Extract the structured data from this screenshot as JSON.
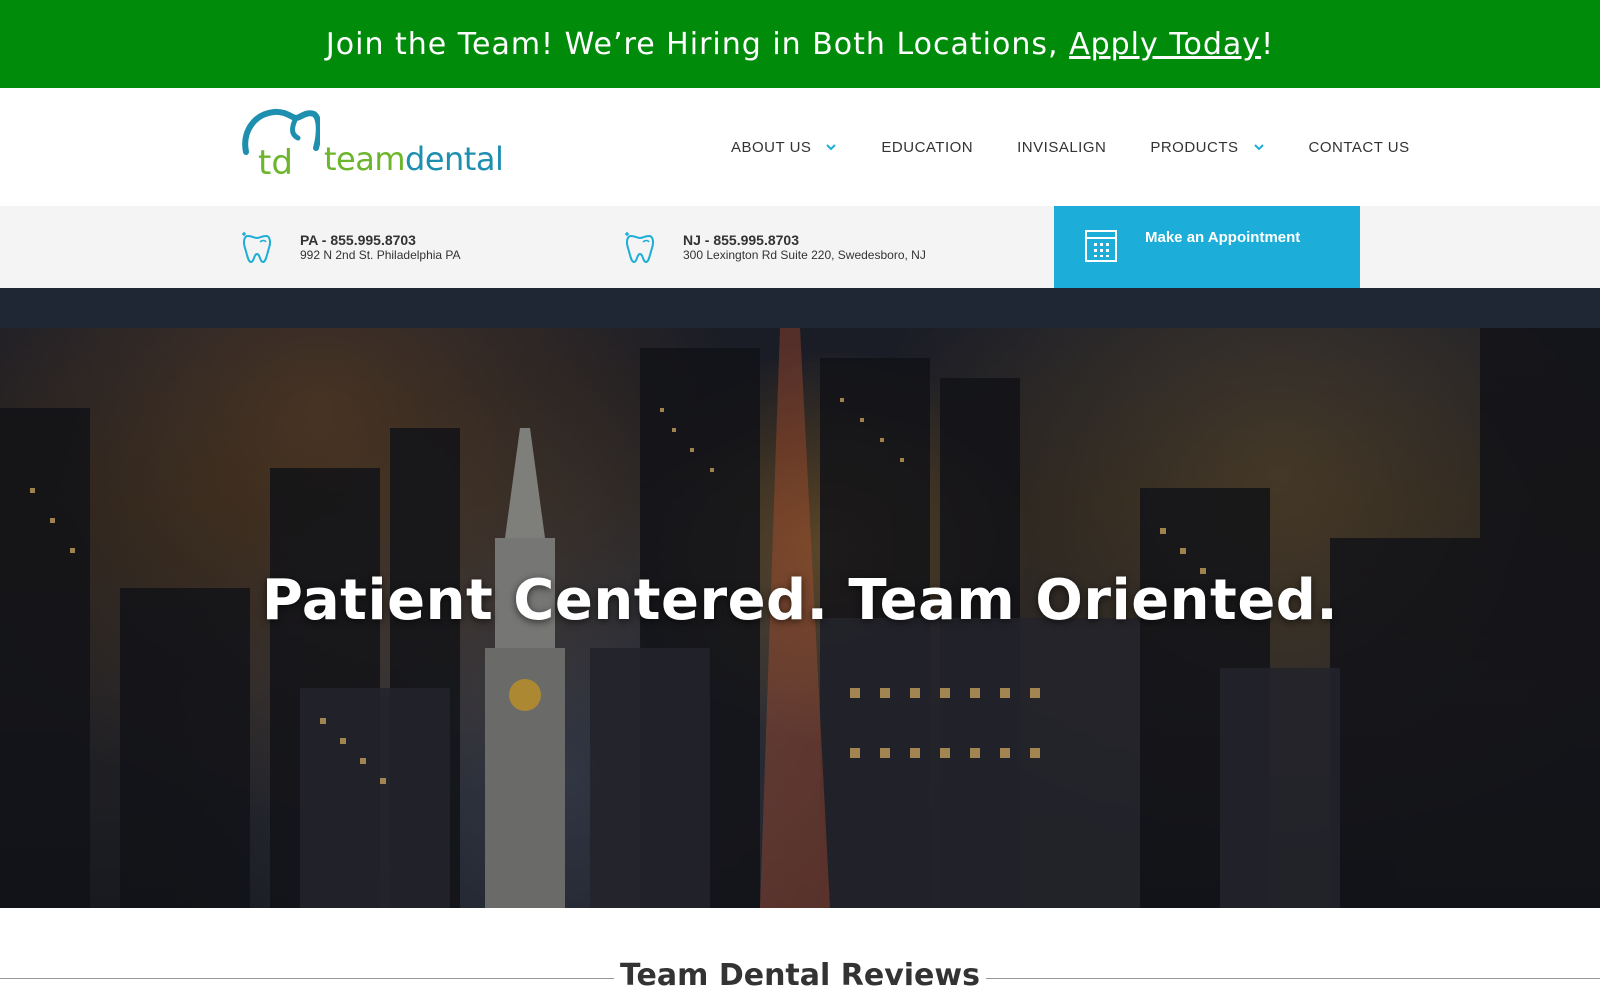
{
  "announcement": {
    "text": "Join the Team! We’re Hiring in Both Locations, ",
    "link_text": "Apply Today",
    "suffix": "!"
  },
  "logo": {
    "mark_text": "td",
    "word_team": "team",
    "word_dental": "dental"
  },
  "nav": {
    "items": [
      {
        "label": "ABOUT US",
        "has_dropdown": true
      },
      {
        "label": "EDUCATION",
        "has_dropdown": false
      },
      {
        "label": "INVISALIGN",
        "has_dropdown": false
      },
      {
        "label": "PRODUCTS",
        "has_dropdown": true
      },
      {
        "label": "CONTACT US",
        "has_dropdown": false
      }
    ]
  },
  "locations": [
    {
      "phone": "PA - 855.995.8703",
      "address": "992 N 2nd St. Philadelphia PA",
      "icon": "tooth-icon"
    },
    {
      "phone": "NJ - 855.995.8703",
      "address": "300 Lexington Rd Suite 220, Swedesboro, NJ",
      "icon": "tooth-icon"
    }
  ],
  "appointment": {
    "label": "Make an Appointment",
    "icon": "calendar-icon"
  },
  "hero": {
    "headline": "Patient Centered. Team Oriented."
  },
  "reviews": {
    "title": "Team Dental Reviews"
  },
  "colors": {
    "announcement_bg": "#008c0a",
    "appointment_bg": "#1caed8",
    "logo_green": "#6cb52d",
    "logo_blue": "#1f8fb0",
    "info_strip_bg": "#f4f4f4"
  }
}
